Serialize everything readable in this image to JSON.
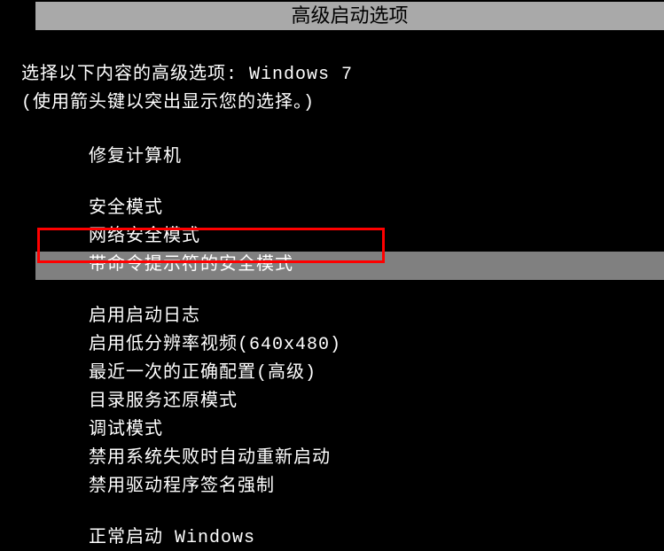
{
  "title": "高级启动选项",
  "prompt": "选择以下内容的高级选项:  Windows 7",
  "hint": "(使用箭头键以突出显示您的选择。)",
  "menu": {
    "items": [
      {
        "label": "修复计算机",
        "selected": false
      },
      {
        "label": "",
        "spacer": true
      },
      {
        "label": "安全模式",
        "selected": false
      },
      {
        "label": "网络安全模式",
        "selected": false
      },
      {
        "label": "带命令提示符的安全模式",
        "selected": true
      },
      {
        "label": "",
        "spacer": true
      },
      {
        "label": "启用启动日志",
        "selected": false
      },
      {
        "label": "启用低分辨率视频(640x480)",
        "selected": false
      },
      {
        "label": "最近一次的正确配置(高级)",
        "selected": false
      },
      {
        "label": "目录服务还原模式",
        "selected": false
      },
      {
        "label": "调试模式",
        "selected": false
      },
      {
        "label": "禁用系统失败时自动重新启动",
        "selected": false
      },
      {
        "label": "禁用驱动程序签名强制",
        "selected": false
      },
      {
        "label": "",
        "spacer": true
      },
      {
        "label": "正常启动 Windows",
        "selected": false
      }
    ]
  }
}
